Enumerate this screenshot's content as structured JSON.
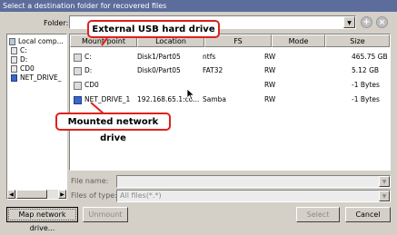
{
  "window": {
    "title": "Select a destination folder for recovered files"
  },
  "folder": {
    "label": "Folder:",
    "value": ""
  },
  "toolbar": {
    "new_folder_icon": "new-folder-icon",
    "delete_icon": "delete-icon"
  },
  "tree": {
    "items": [
      {
        "label": "Local comp...",
        "icon": "computer-icon"
      },
      {
        "label": "C:",
        "icon": "drive-icon"
      },
      {
        "label": "D:",
        "icon": "drive-icon"
      },
      {
        "label": "CD0",
        "icon": "drive-icon"
      },
      {
        "label": "NET_DRIVE_",
        "icon": "network-drive-icon"
      }
    ]
  },
  "table": {
    "columns": [
      "Mount point",
      "Location",
      "FS",
      "Mode",
      "Size"
    ],
    "rows": [
      {
        "mount": "C:",
        "location": "Disk1/Part05",
        "fs": "ntfs",
        "mode": "RW",
        "size": "465.75 GB",
        "icon": "drive-icon"
      },
      {
        "mount": "D:",
        "location": "Disk0/Part05",
        "fs": "FAT32",
        "mode": "RW",
        "size": "5.12 GB",
        "icon": "drive-icon"
      },
      {
        "mount": "CD0",
        "location": "",
        "fs": "",
        "mode": "RW",
        "size": "-1 Bytes",
        "icon": "drive-icon"
      },
      {
        "mount": "NET_DRIVE_1",
        "location": "192.168.65.1:co...",
        "fs": "Samba",
        "mode": "RW",
        "size": "-1 Bytes",
        "icon": "network-drive-icon"
      }
    ]
  },
  "annotations": {
    "usb": "External USB hard drive",
    "network": "Mounted network drive"
  },
  "file_name": {
    "label": "File name:",
    "value": ""
  },
  "file_type": {
    "label": "Files of type:",
    "value": "All files(*.*)"
  },
  "buttons": {
    "map": "Map network drive...",
    "unmount": "Unmount",
    "select": "Select",
    "cancel": "Cancel"
  },
  "colors": {
    "titlebar": "#5c6d9b",
    "callout_border": "#e0201c",
    "window_bg": "#d4d0c8"
  }
}
